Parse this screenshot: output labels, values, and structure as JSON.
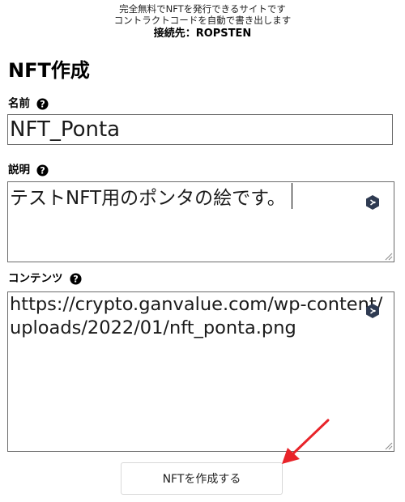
{
  "header": {
    "line1": "完全無料でNFTを発行できるサイトです",
    "line2": "コントラクトコードを自動で書き出します",
    "connection": "接続先：ROPSTEN"
  },
  "page_title": "NFT作成",
  "fields": {
    "name": {
      "label": "名前",
      "value": "NFT_Ponta"
    },
    "description": {
      "label": "説明",
      "value": "テストNFT用のポンタの絵です。"
    },
    "contents": {
      "label": "コンテンツ",
      "value": "https://crypto.ganvalue.com/wp-content/uploads/2022/01/nft_ponta.png"
    }
  },
  "submit_button": {
    "label": "NFTを作成する"
  },
  "colors": {
    "annotation_arrow": "#e8242a",
    "extension_icon": "#2f3b52"
  },
  "icons": {
    "help": "question-circle-icon",
    "extension": "hexagon-extension-icon",
    "resize": "resize-grip-icon",
    "annotation": "red-arrow-icon"
  }
}
